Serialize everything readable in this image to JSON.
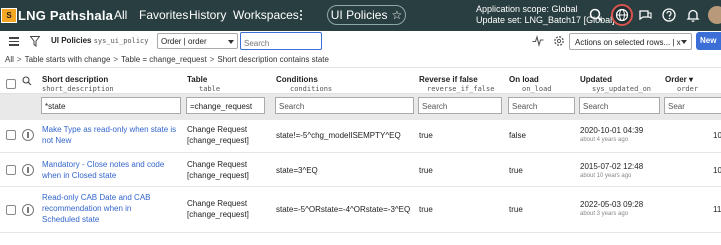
{
  "banner": {
    "logo_badge": "S",
    "logo_text": "LNG Pathshala",
    "nav": [
      "All",
      "Favorites",
      "History",
      "Workspaces"
    ],
    "context_title": "UI Policies",
    "scope_line1": "Application scope: Global",
    "scope_line2": "Update set: LNG_Batch17 [Global]"
  },
  "toolbar": {
    "title": "UI Policies",
    "table_name": "sys_ui_policy",
    "search_field_value": "Order | order",
    "search_placeholder": "Search",
    "actions_label": "Actions on selected rows... | x",
    "new_label": "New"
  },
  "breadcrumb": [
    "All",
    "Table starts with change",
    "Table = change_request",
    "Short description contains state"
  ],
  "columns": [
    {
      "label": "Short description",
      "field": "short_description"
    },
    {
      "label": "Table",
      "field": "table"
    },
    {
      "label": "Conditions",
      "field": "conditions"
    },
    {
      "label": "Reverse if false",
      "field": "reverse_if_false"
    },
    {
      "label": "On load",
      "field": "on_load"
    },
    {
      "label": "Updated",
      "field": "sys_updated_on"
    },
    {
      "label": "Order",
      "field": "order"
    }
  ],
  "filters": {
    "short_description": "*state",
    "table": "=change_request",
    "conditions": "Search",
    "reverse_if_false": "Search",
    "on_load": "Search",
    "updated": "Search",
    "order": "Sear"
  },
  "rows": [
    {
      "short_description": "Make Type as read-only when state is not New",
      "table_line1": "Change Request",
      "table_line2": "[change_request]",
      "conditions": "state!=-5^chg_modelISEMPTY^EQ",
      "reverse_if_false": "true",
      "on_load": "false",
      "updated": "2020-10-01 04:39",
      "updated_ago": "about 4 years ago",
      "order": "10"
    },
    {
      "short_description": "Mandatory - Close notes and code when in Closed state",
      "table_line1": "Change Request",
      "table_line2": "[change_request]",
      "conditions": "state=3^EQ",
      "reverse_if_false": "true",
      "on_load": "true",
      "updated": "2015-07-02 12:48",
      "updated_ago": "about 10 years ago",
      "order": "10"
    },
    {
      "short_description": "Read-only CAB Date and CAB recommendation when in Scheduled state",
      "table_line1": "Change Request",
      "table_line2": "[change_request]",
      "conditions": "state=-5^ORstate=-4^ORstate=-3^EQ",
      "reverse_if_false": "true",
      "on_load": "true",
      "updated": "2022-05-03 09:28",
      "updated_ago": "about 3 years ago",
      "order": "11"
    }
  ],
  "colors": {
    "banner_bg": "#293e40",
    "link": "#3366cc",
    "primary_button": "#3b6ed6",
    "logo_badge": "#f5a623"
  },
  "icons": [
    "hamburger-icon",
    "filter-icon",
    "search-icon",
    "globe-icon",
    "chat-icon",
    "help-icon",
    "bell-icon",
    "settings-icon",
    "personalize-icon",
    "star-icon",
    "info-icon"
  ]
}
